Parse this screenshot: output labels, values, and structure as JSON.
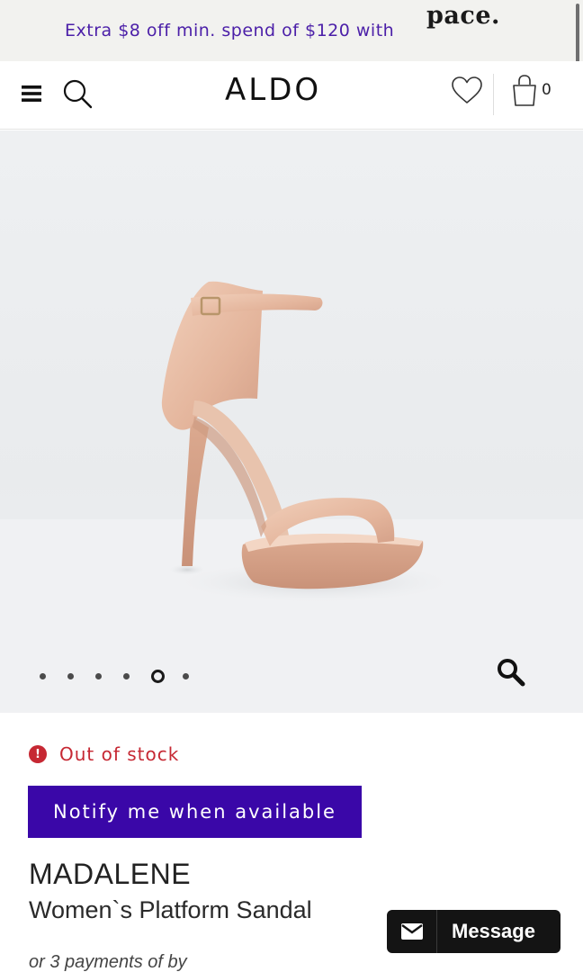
{
  "promo": {
    "text": "Extra $8 off min. spend of $120 with",
    "brand": "pace."
  },
  "header": {
    "logo": "ALDO",
    "bag_count": "0",
    "icons": {
      "menu": "menu-icon",
      "search": "search-icon",
      "wishlist": "heart-icon",
      "bag": "shopping-bag-icon"
    }
  },
  "gallery": {
    "total_images": 6,
    "active_index": 4
  },
  "product": {
    "stock_icon": "!",
    "stock_status": "Out of stock",
    "notify_label": "Notify me when available",
    "name": "MADALENE",
    "subtitle": "Women`s Platform Sandal",
    "payments_text": "or 3 payments of by"
  },
  "chat": {
    "label": "Message",
    "icon": "envelope-icon"
  },
  "colors": {
    "promo_text": "#4b1fa8",
    "notify_button": "#3a07a8",
    "out_of_stock": "#c62833",
    "chat_button": "#141414"
  }
}
